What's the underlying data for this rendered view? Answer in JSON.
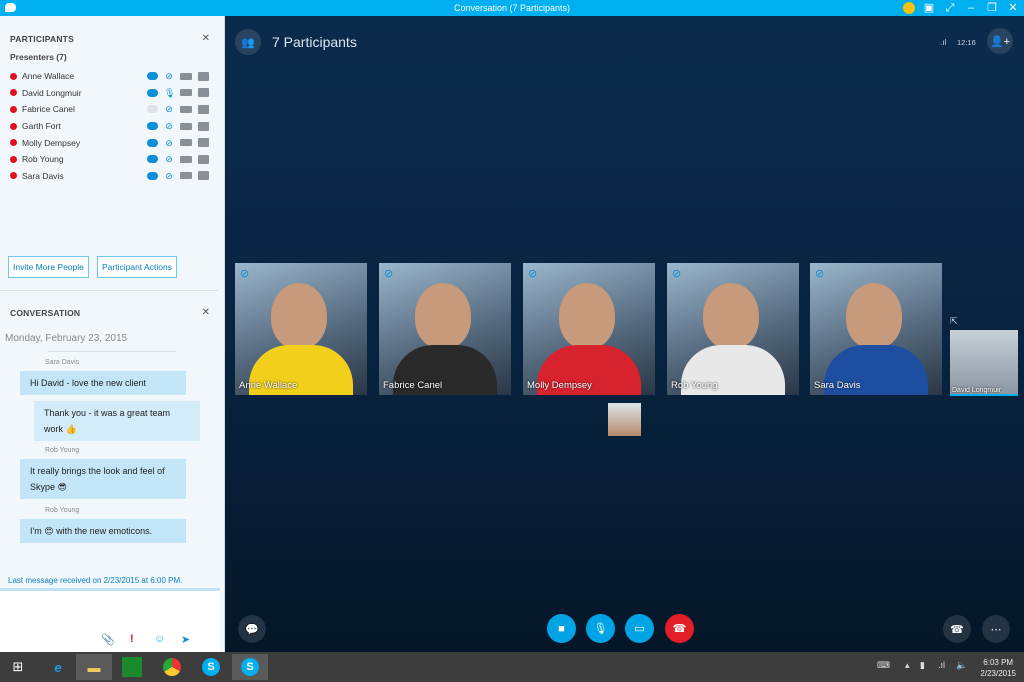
{
  "window": {
    "title": "Conversation (7 Participants)",
    "controls": [
      "emoticon-icon",
      "layout-icon",
      "fullscreen-icon",
      "minimize",
      "restore",
      "close"
    ]
  },
  "participants_panel": {
    "heading": "PARTICIPANTS",
    "group": "Presenters (7)",
    "people": [
      {
        "name": "Anne Wallace",
        "im": "active",
        "mic": "muted"
      },
      {
        "name": "David Longmuir",
        "im": "active",
        "mic": "speaking"
      },
      {
        "name": "Fabrice Canel",
        "im": "inactive",
        "mic": "muted"
      },
      {
        "name": "Garth Fort",
        "im": "active",
        "mic": "muted"
      },
      {
        "name": "Molly Dempsey",
        "im": "active",
        "mic": "muted"
      },
      {
        "name": "Rob Young",
        "im": "active",
        "mic": "muted"
      },
      {
        "name": "Sara Davis",
        "im": "active",
        "mic": "muted"
      }
    ],
    "invite_label": "Invite More People",
    "actions_label": "Participant Actions"
  },
  "conversation_panel": {
    "heading": "CONVERSATION",
    "date": "Monday, February 23, 2015",
    "messages": [
      {
        "sender": "Sara Davis",
        "text": "Hi David - love the new client",
        "side": "left"
      },
      {
        "sender": "",
        "text": "Thank you - it was a great team work",
        "emoji": "thumbs-up",
        "side": "right"
      },
      {
        "sender": "Rob Young",
        "text": "It really brings the look and feel of Skype",
        "emoji": "cool",
        "side": "left"
      },
      {
        "sender": "Rob Young",
        "text": "I'm [emoji] with the new emoticons.",
        "emoji": "in-love",
        "side": "left"
      }
    ],
    "last_message": "Last message received on 2/23/2015 at 6:00 PM."
  },
  "stage": {
    "title": "7 Participants",
    "call_time": "12:16",
    "tiles": [
      {
        "name": "Anne Wallace",
        "muted": true,
        "shirt": "#f1cf1a"
      },
      {
        "name": "Fabrice Canel",
        "muted": true,
        "shirt": "#2a2a2a"
      },
      {
        "name": "Molly Dempsey",
        "muted": true,
        "shirt": "#d8232e"
      },
      {
        "name": "Rob Young",
        "muted": true,
        "shirt": "#e8e8e8"
      },
      {
        "name": "Sara Davis",
        "muted": true,
        "shirt": "#1e4ea0"
      }
    ],
    "active_speaker": "David Longmuir"
  },
  "taskbar": {
    "time": "6:03 PM",
    "date": "2/23/2015"
  },
  "colors": {
    "accent": "#00aff0",
    "end_call": "#e41e26",
    "presence_busy": "#e0101e"
  }
}
